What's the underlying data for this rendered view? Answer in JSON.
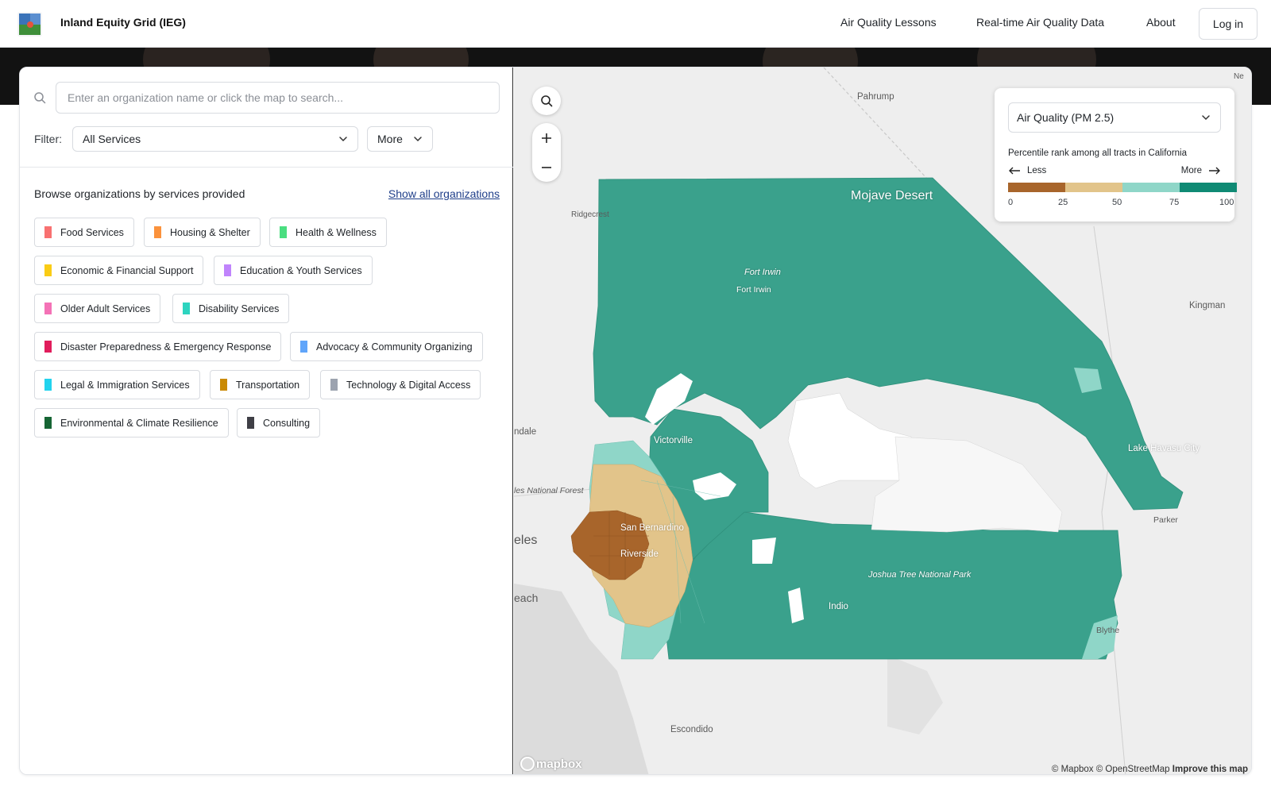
{
  "app": {
    "title": "Inland Equity Grid (IEG)",
    "nav": [
      "Air Quality Lessons",
      "Real-time Air Quality Data",
      "About"
    ],
    "login_label": "Log in"
  },
  "search": {
    "placeholder": "Enter an organization name or click the map to search...",
    "value": ""
  },
  "filter": {
    "label": "Filter:",
    "selected": "All Services",
    "more_label": "More"
  },
  "browse": {
    "title": "Browse organizations by services provided",
    "show_all_label": "Show all organizations"
  },
  "services": [
    {
      "label": "Food Services",
      "color": "#f87171"
    },
    {
      "label": "Housing & Shelter",
      "color": "#fb923c"
    },
    {
      "label": "Health & Wellness",
      "color": "#4ade80"
    },
    {
      "label": "Economic & Financial Support",
      "color": "#facc15"
    },
    {
      "label": "Education & Youth Services",
      "color": "#c084fc"
    },
    {
      "label": "Older Adult Services",
      "color": "#f472b6"
    },
    {
      "label": "Disability Services",
      "color": "#2dd4bf"
    },
    {
      "label": "Disaster Preparedness & Emergency Response",
      "color": "#e11d5c"
    },
    {
      "label": "Advocacy & Community Organizing",
      "color": "#60a5fa"
    },
    {
      "label": "Legal & Immigration Services",
      "color": "#22d3ee"
    },
    {
      "label": "Transportation",
      "color": "#ca8a04"
    },
    {
      "label": "Technology & Digital Access",
      "color": "#9ca3af"
    },
    {
      "label": "Environmental & Climate Resilience",
      "color": "#166534"
    },
    {
      "label": "Consulting",
      "color": "#3f3f46"
    }
  ],
  "map": {
    "layer_selected": "Air Quality (PM 2.5)",
    "legend": {
      "title": "Percentile rank among all tracts in California",
      "less_label": "Less",
      "more_label": "More",
      "ticks": [
        "0",
        "25",
        "50",
        "75",
        "100"
      ],
      "colors": [
        "#a8652b",
        "#e2c48a",
        "#8fd6c8",
        "#0f8a74"
      ]
    },
    "place_labels": {
      "pahrump": "Pahrump",
      "ridgecrest": "Ridgecrest",
      "mojave": "Mojave Desert",
      "fort_irwin_a": "Fort Irwin",
      "fort_irwin_b": "Fort Irwin",
      "kingman": "Kingman",
      "victorville": "Victorville",
      "ndale": "ndale",
      "national_forest": "les National Forest",
      "les": "eles",
      "san_bernardino": "San Bernardino",
      "riverside": "Riverside",
      "lake_havasu": "Lake Havasu City",
      "parker": "Parker",
      "joshua_tree": "Joshua Tree National Park",
      "each": "each",
      "indio": "Indio",
      "blythe": "Blythe",
      "escondido": "Escondido",
      "ne": "Ne"
    },
    "attribution": {
      "mapbox": "© Mapbox",
      "osm": "© OpenStreetMap",
      "improve": "Improve this map"
    },
    "logo_text": "mapbox",
    "fill_color": "#3aa18c"
  }
}
